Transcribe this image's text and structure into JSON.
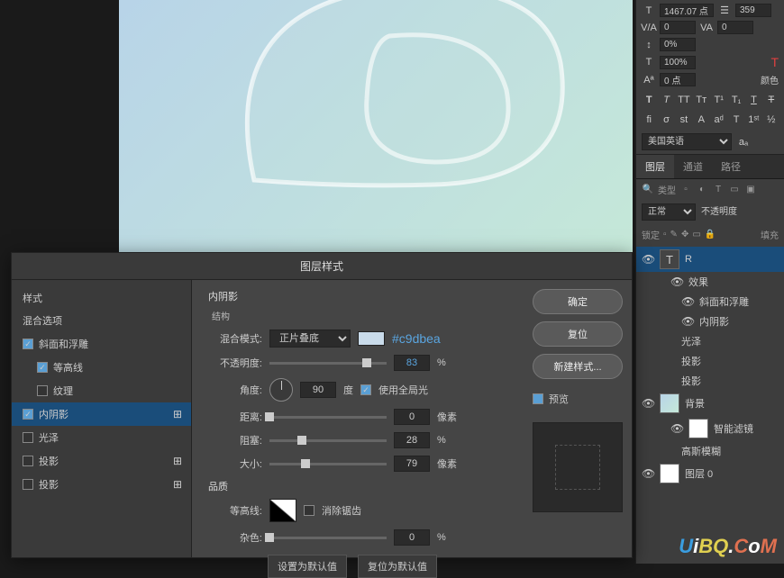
{
  "char_panel": {
    "font_size": "1467.07 点",
    "leading": "359",
    "va": "0",
    "tracking": "0",
    "vert_scale": "0%",
    "horiz_scale": "100%",
    "baseline": "0 点",
    "color_label": "颜色",
    "language": "美国英语"
  },
  "panels": {
    "tab_layers": "图层",
    "tab_channels": "通道",
    "tab_paths": "路径",
    "filter_label": "类型",
    "blend_mode": "正常",
    "opacity_label": "不透明度",
    "lock_label": "锁定",
    "fill_label": "填充"
  },
  "layers": {
    "r": "R",
    "effects": "效果",
    "bevel": "斜面和浮雕",
    "inner_shadow": "内阴影",
    "gloss": "光泽",
    "drop_shadow": "投影",
    "drop_shadow2": "投影",
    "bg": "背景",
    "smart_filter": "智能滤镜",
    "gaussian": "高斯模糊",
    "layer0": "图层 0"
  },
  "dialog": {
    "title": "图层样式",
    "styles_header": "样式",
    "blending_options": "混合选项",
    "bevel_emboss": "斜面和浮雕",
    "contour": "等高线",
    "texture": "纹理",
    "inner_shadow": "内阴影",
    "satin": "光泽",
    "drop_shadow": "投影",
    "drop_shadow2": "投影",
    "section_title": "内阴影",
    "section_sub": "结构",
    "blend_mode_label": "混合模式:",
    "blend_mode_value": "正片叠底",
    "color_hex": "#c9dbea",
    "opacity_label": "不透明度:",
    "opacity_value": "83",
    "pct": "%",
    "angle_label": "角度:",
    "angle_value": "90",
    "angle_unit": "度",
    "global_light": "使用全局光",
    "distance_label": "距离:",
    "distance_value": "0",
    "px": "像素",
    "choke_label": "阻塞:",
    "choke_value": "28",
    "size_label": "大小:",
    "size_value": "79",
    "quality_header": "品质",
    "contour_label": "等高线:",
    "antialias": "消除锯齿",
    "noise_label": "杂色:",
    "noise_value": "0",
    "set_default": "设置为默认值",
    "reset_default": "复位为默认值",
    "ok": "确定",
    "reset": "复位",
    "new_style": "新建样式...",
    "preview": "预览"
  },
  "watermark": {
    "u": "U",
    "i": "i",
    "bq": "BQ",
    "dot": ".",
    "c": "C",
    "o": "o",
    "m": "M"
  }
}
